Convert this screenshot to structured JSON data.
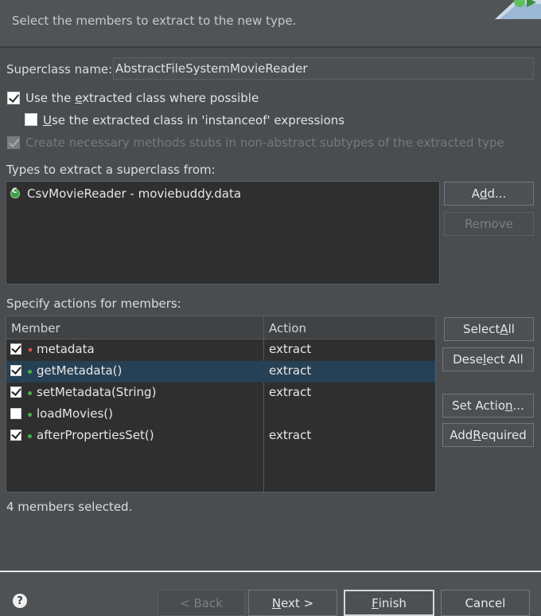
{
  "header": {
    "description": "Select the members to extract to the new type.",
    "icon": "wizard-banner-icon"
  },
  "superclass": {
    "label": "Superclass name:",
    "value": "AbstractFileSystemMovieReader"
  },
  "options": {
    "use_extracted_pre": "Use the ",
    "use_extracted_u": "e",
    "use_extracted_post": "xtracted class where possible",
    "instanceof_u": "U",
    "instanceof_post": "se the extracted class in 'instanceof' expressions",
    "create_stubs": "Create necessary methods stubs in non-abstract subtypes of the extracted type"
  },
  "types": {
    "label": "Types to extract a superclass from:",
    "items": [
      "CsvMovieReader - moviebuddy.data"
    ],
    "add_pre": "A",
    "add_u": "d",
    "add_post": "d...",
    "remove_label": "Remove"
  },
  "members": {
    "label": "Specify actions for members:",
    "columns": [
      "Member",
      "Action"
    ],
    "rows": [
      {
        "name": "metadata",
        "action": "extract",
        "checked": true,
        "kind": "field",
        "color": "#e04848"
      },
      {
        "name": "getMetadata()",
        "action": "extract",
        "checked": true,
        "kind": "method",
        "color": "#46b04e"
      },
      {
        "name": "setMetadata(String)",
        "action": "extract",
        "checked": true,
        "kind": "method",
        "color": "#46b04e"
      },
      {
        "name": "loadMovies()",
        "action": "",
        "checked": false,
        "kind": "method",
        "color": "#46b04e"
      },
      {
        "name": "afterPropertiesSet()",
        "action": "extract",
        "checked": true,
        "kind": "method",
        "color": "#46b04e"
      }
    ],
    "select_all_pre": "Select ",
    "select_all_u": "A",
    "select_all_post": "ll",
    "deselect_pre": "Dese",
    "deselect_u": "l",
    "deselect_post": "ect All",
    "set_action_pre": "Set Actio",
    "set_action_u": "n",
    "set_action_post": "...",
    "add_required_pre": "Add ",
    "add_required_u": "R",
    "add_required_post": "equired",
    "status": "4 members selected."
  },
  "footer": {
    "help_glyph": "?",
    "back_label": "< Back",
    "next_u": "N",
    "next_post": "ext >",
    "finish_u": "F",
    "finish_post": "inish",
    "cancel_label": "Cancel"
  }
}
